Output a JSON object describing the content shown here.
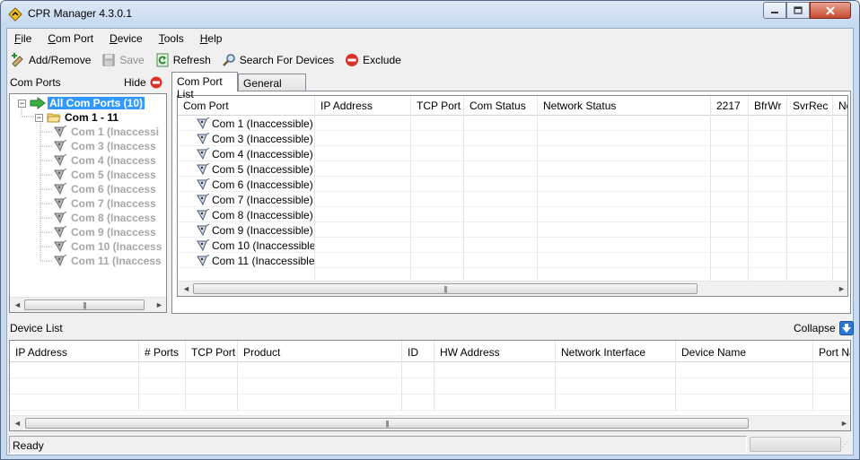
{
  "window": {
    "title": "CPR Manager 4.3.0.1"
  },
  "menu": [
    {
      "underline": "F",
      "rest": "ile"
    },
    {
      "underline": "C",
      "rest": "om Port"
    },
    {
      "underline": "D",
      "rest": "evice"
    },
    {
      "underline": "T",
      "rest": "ools"
    },
    {
      "underline": "H",
      "rest": "elp"
    }
  ],
  "toolbar": {
    "add_remove": "Add/Remove",
    "save": "Save",
    "refresh": "Refresh",
    "search": "Search For Devices",
    "exclude": "Exclude"
  },
  "left_panel": {
    "title": "Com Ports",
    "hide": "Hide",
    "tree": {
      "root": "All Com Ports (10)",
      "group": "Com 1 - 11",
      "leaves": [
        "Com 1 (Inaccessi",
        "Com 3 (Inaccess",
        "Com 4 (Inaccess",
        "Com 5 (Inaccess",
        "Com 6 (Inaccess",
        "Com 7 (Inaccess",
        "Com 8 (Inaccess",
        "Com 9 (Inaccess",
        "Com 10 (Inaccess",
        "Com 11 (Inaccess"
      ]
    }
  },
  "tabs": [
    {
      "label": "Com Port List",
      "active": true
    },
    {
      "label": "General Tests",
      "active": false
    }
  ],
  "com_port_grid": {
    "columns": [
      "Com Port",
      "IP Address",
      "TCP Port",
      "Com Status",
      "Network Status",
      "2217",
      "BfrWr",
      "SvrRec",
      "No"
    ],
    "rows": [
      "Com 1 (Inaccessible)",
      "Com 3 (Inaccessible)",
      "Com 4 (Inaccessible)",
      "Com 5 (Inaccessible)",
      "Com 6 (Inaccessible)",
      "Com 7 (Inaccessible)",
      "Com 8 (Inaccessible)",
      "Com 9 (Inaccessible)",
      "Com 10 (Inaccessible)",
      "Com 11 (Inaccessible)"
    ]
  },
  "device_list": {
    "title": "Device List",
    "collapse": "Collapse",
    "columns": [
      "IP Address",
      "# Ports",
      "TCP Port",
      "Product",
      "ID",
      "HW Address",
      "Network Interface",
      "Device Name",
      "Port Nar"
    ]
  },
  "status": {
    "text": "Ready"
  },
  "colors": {
    "selection": "#3399ff",
    "disabled_text": "#a8a8a8",
    "exclude_red": "#d9342b",
    "collapse_blue": "#2b78d6"
  }
}
